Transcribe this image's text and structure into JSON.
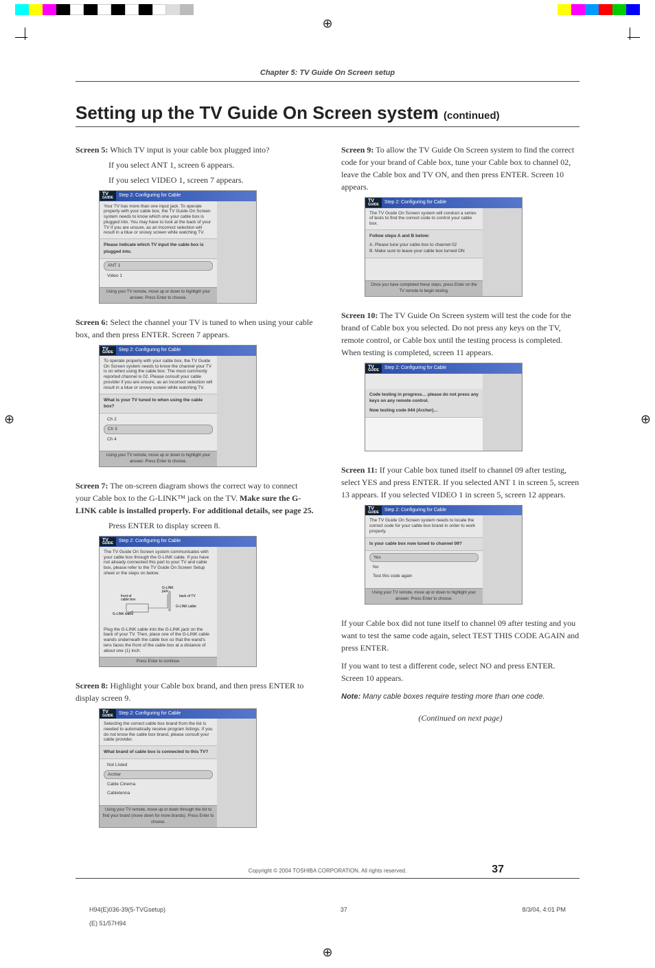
{
  "chapter": "Chapter 5: TV Guide On Screen setup",
  "heading": "Setting up the TV Guide On Screen system",
  "heading_cont": "(continued)",
  "left": {
    "s5": {
      "label": "Screen 5:",
      "text": "Which TV input is your cable box plugged into?",
      "line2": "If you select ANT 1, screen 6 appears.",
      "line3": "If you select VIDEO 1, screen 7 appears.",
      "tv_header": "Step 2: Configuring for Cable",
      "tv_text": "Your TV has more than one input jack. To operate properly with your cable box, the TV Guide On Screen system needs to know which one your cable box is plugged into. You may have to look at the back of your TV if you are unsure, as an incorrect selection will result in a blue or snowy screen while watching TV.",
      "tv_question": "Please indicate which TV input the cable box is plugged into.",
      "opt1": "ANT 1",
      "opt2": "Video 1",
      "tv_footer": "Using your TV remote, move up or down to highlight your answer. Press Enter to choose."
    },
    "s6": {
      "label": "Screen 6:",
      "text": "Select the channel your TV is tuned to when using your cable box, and then press ENTER. Screen 7 appears.",
      "tv_header": "Step 2: Configuring for Cable",
      "tv_text": "To operate properly with your cable box, the TV Guide On Screen system needs to know the channel your TV is on when using the cable box. The most commonly reported channel is 02. Please consult your cable provider if you are unsure, as an incorrect selection will result in a blue or snowy screen while watching TV.",
      "tv_question": "What is your TV tuned to when using the cable box?",
      "opt1": "Ch 2",
      "opt2": "Ch 3",
      "opt3": "Ch 4",
      "tv_footer": "Using your TV remote, move up or down to highlight your answer. Press Enter to choose."
    },
    "s7": {
      "label": "Screen 7:",
      "text1": "The on-screen diagram shows the correct way to connect your Cable box to the G-LINK™ jack on the TV.",
      "bold": "Make sure the G-LINK cable is installed properly. For additional details, see page 25.",
      "text2": "Press ENTER to display screen 8.",
      "tv_header": "Step 2: Configuring for Cable",
      "tv_text": "The TV Guide On Screen system communicates with your cable box through the G-LINK cable. If you have not already connected this part to your TV and cable box, please refer to the TV Guide On Screen Setup sheet or the steps on below.",
      "d_glink": "G-LINK jack",
      "d_front": "front of cable box",
      "d_back": "back of TV",
      "d_cable": "G-LINK cable",
      "d_wand": "G-LINK wand",
      "tv_text2": "Plug the G-LINK cable into the G-LINK jack on the back of your TV. Then, place one of the G-LINK cable wands underneath the cable box so that the wand's lens faces the front of the cable box at a distance of about one (1) inch.",
      "tv_footer": "Press Enter to continue."
    },
    "s8": {
      "label": "Screen 8:",
      "text": "Highlight your Cable box brand, and then press ENTER to display screen 9.",
      "tv_header": "Step 2: Configuring for Cable",
      "tv_text": "Selecting the correct cable box brand from the list is needed to automatically receive program listings. If you do not know the cable box brand, please consult your cable provider.",
      "tv_question": "What brand of cable box is connected to this TV?",
      "opt1": "Not Listed",
      "opt2": "Archer",
      "opt3": "Cable Cinema",
      "opt4": "Cabletenna",
      "tv_footer": "Using your TV remote, move up or down through the list to find your brand (move down for more brands). Press Enter to choose."
    }
  },
  "right": {
    "s9": {
      "label": "Screen 9:",
      "text": "To allow the TV Guide On Screen system to find the correct code for your brand of Cable box, tune your Cable box to channel 02, leave the Cable box and TV ON, and then press ENTER. Screen 10 appears.",
      "tv_header": "Step 2: Configuring for Cable",
      "tv_text": "The TV Guide On Screen system will conduct a series of tests to find the correct code to control your cable box.",
      "steps_title": "Follow steps A and B below:",
      "step_a": "A.  Please tune your cable box to channel 02",
      "step_b": "B.  Make sure to leave your cable box turned ON",
      "tv_footer": "Once you have completed these steps, press Enter on the TV remote to begin testing."
    },
    "s10": {
      "label": "Screen 10:",
      "text": "The TV Guide On Screen system will test the code for the brand of Cable box you selected. Do not press any keys on the TV, remote control, or Cable box until the testing process is completed. When testing is completed, screen 11 appears.",
      "tv_header": "Step 2: Configuring for Cable",
      "tv_line1": "Code testing in progress… please do not press any keys on any remote control.",
      "tv_line2": "Now testing code 044 (Archer)…"
    },
    "s11": {
      "label": "Screen 11:",
      "text": "If your Cable box tuned itself to channel 09 after testing, select YES and press ENTER. If you selected ANT 1 in screen 5, screen 13 appears. If you selected VIDEO 1 in screen 5, screen 12 appears.",
      "tv_header": "Step 2: Configuring for Cable",
      "tv_text": "The TV Guide On Screen system needs to locate the correct code for your cable box brand in order to work properly.",
      "tv_question": "Is your cable box now tuned to channel 09?",
      "opt1": "Yes",
      "opt2": "No",
      "opt3": "Test this code again",
      "tv_footer": "Using your TV remote, move up or down to highlight your answer. Press Enter to choose.",
      "after1": "If your Cable box did not tune itself to channel 09 after testing and you want to test the same code again, select TEST THIS CODE AGAIN and press ENTER.",
      "after2": "If you want to test a different code, select NO and press ENTER. Screen 10 appears."
    },
    "note_label": "Note:",
    "note_text": "Many cable boxes require testing more than one code.",
    "continued": "(Continued on next page)"
  },
  "copyright": "Copyright © 2004 TOSHIBA CORPORATION. All rights reserved.",
  "pagenum": "37",
  "docinfo_left": "H94(E)036-39(5-TVGsetup)",
  "docinfo_mid": "37",
  "docinfo_right": "8/3/04, 4:01 PM",
  "docinfo_sub": "(E) 51/57H94"
}
